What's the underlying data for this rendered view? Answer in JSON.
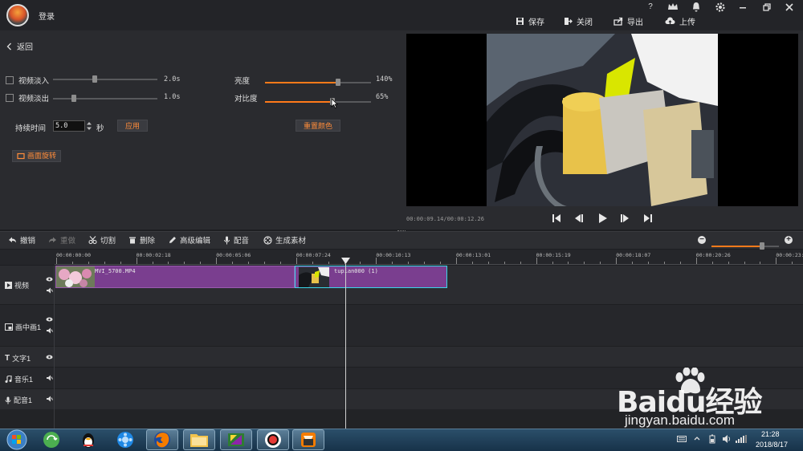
{
  "title_bar": {
    "login_label": "登录",
    "help": "?",
    "vip": "VIP",
    "save": "保存",
    "close": "关闭",
    "export": "导出",
    "upload": "上传"
  },
  "left_panel": {
    "back_label": "返回",
    "fade_in": {
      "label": "视频淡入",
      "value": "2.0s",
      "level": 0.4,
      "checked": false
    },
    "fade_out": {
      "label": "视频淡出",
      "value": "1.0s",
      "level": 0.2,
      "checked": false
    },
    "brightness": {
      "label": "亮度",
      "value": "140%",
      "level": 0.69
    },
    "contrast": {
      "label": "对比度",
      "value": "65%",
      "level": 0.64
    },
    "duration_label": "持续时间",
    "duration_value": "5.0",
    "duration_unit": "秒",
    "apply_label": "应用",
    "reset_color_label": "重置颜色",
    "rotate_label": "画面旋转"
  },
  "preview": {
    "timecode": "00:00:09.14/00:00:12.26"
  },
  "toolbar": {
    "undo": "撤销",
    "redo": "重做",
    "cut": "切割",
    "delete": "删除",
    "advanced_edit": "高级编辑",
    "dub": "配音",
    "generate": "生成素材",
    "zoom_level": 0.75
  },
  "timeline": {
    "ruler_ticks": [
      "00:00:00:00",
      "00:00:02:18",
      "00:00:05:06",
      "00:00:07:24",
      "00:00:10:13",
      "00:00:13:01",
      "00:00:15:19",
      "00:00:18:07",
      "00:00:20:26",
      "00:00:23:"
    ],
    "tracks": {
      "video": "视频",
      "pip": "画中画1",
      "text": "文字1",
      "music": "音乐1",
      "voice": "配音1"
    },
    "clips": [
      {
        "name": "MVI_5700.MP4"
      },
      {
        "name": "tupian000 (1)"
      }
    ]
  },
  "taskbar": {
    "time": "21:28",
    "date": "2018/8/17"
  },
  "watermark": {
    "brand": "Baidu经验",
    "url": "jingyan.baidu.com"
  }
}
